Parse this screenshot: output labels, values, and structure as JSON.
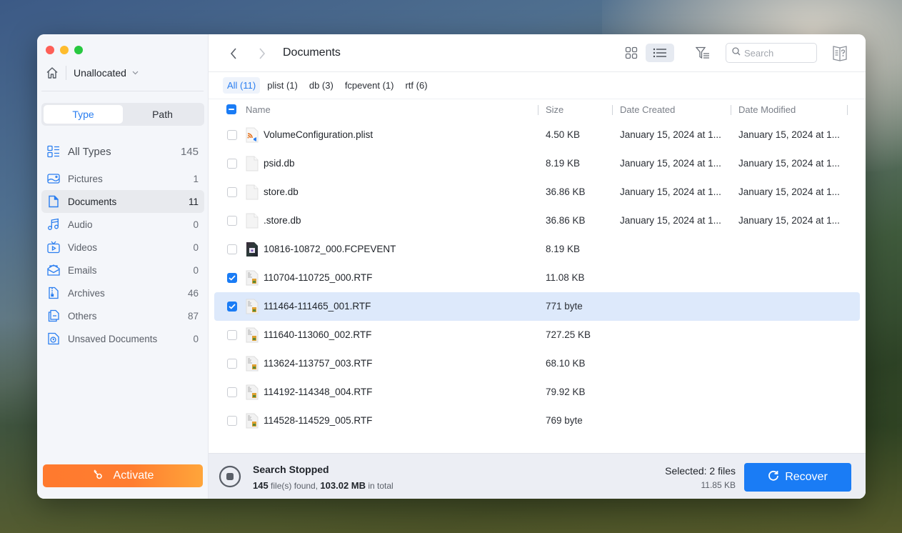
{
  "window": {
    "traffic_lights": [
      "close",
      "minimize",
      "maximize"
    ]
  },
  "sidebar": {
    "location": {
      "icon": "home-icon",
      "label": "Unallocated",
      "chevron": "chevron-down-icon"
    },
    "segments": [
      {
        "label": "Type",
        "active": true
      },
      {
        "label": "Path",
        "active": false
      }
    ],
    "types": [
      {
        "icon": "all-types-icon",
        "label": "All Types",
        "count": "145",
        "active": false
      },
      {
        "icon": "pictures-icon",
        "label": "Pictures",
        "count": "1",
        "active": false
      },
      {
        "icon": "documents-icon",
        "label": "Documents",
        "count": "11",
        "active": true
      },
      {
        "icon": "audio-icon",
        "label": "Audio",
        "count": "0",
        "active": false
      },
      {
        "icon": "videos-icon",
        "label": "Videos",
        "count": "0",
        "active": false
      },
      {
        "icon": "emails-icon",
        "label": "Emails",
        "count": "0",
        "active": false
      },
      {
        "icon": "archives-icon",
        "label": "Archives",
        "count": "46",
        "active": false
      },
      {
        "icon": "others-icon",
        "label": "Others",
        "count": "87",
        "active": false
      },
      {
        "icon": "unsaved-documents-icon",
        "label": "Unsaved Documents",
        "count": "0",
        "active": false
      }
    ],
    "activate_label": "Activate"
  },
  "toolbar": {
    "breadcrumb": "Documents",
    "search_placeholder": "Search",
    "search_value": "",
    "view_mode": "list"
  },
  "filters": [
    {
      "label": "All (11)",
      "active": true
    },
    {
      "label": "plist (1)",
      "active": false
    },
    {
      "label": "db (3)",
      "active": false
    },
    {
      "label": "fcpevent (1)",
      "active": false
    },
    {
      "label": "rtf (6)",
      "active": false
    }
  ],
  "table": {
    "columns": [
      "Name",
      "Size",
      "Date Created",
      "Date Modified"
    ],
    "header_checkbox": "mixed",
    "rows": [
      {
        "name": "VolumeConfiguration.plist",
        "type": "plist",
        "size": "4.50 KB",
        "created": "January 15, 2024 at 1...",
        "modified": "January 15, 2024 at 1...",
        "checked": false,
        "selected": false
      },
      {
        "name": "psid.db",
        "type": "db",
        "size": "8.19 KB",
        "created": "January 15, 2024 at 1...",
        "modified": "January 15, 2024 at 1...",
        "checked": false,
        "selected": false
      },
      {
        "name": "store.db",
        "type": "db",
        "size": "36.86 KB",
        "created": "January 15, 2024 at 1...",
        "modified": "January 15, 2024 at 1...",
        "checked": false,
        "selected": false
      },
      {
        "name": ".store.db",
        "type": "db",
        "size": "36.86 KB",
        "created": "January 15, 2024 at 1...",
        "modified": "January 15, 2024 at 1...",
        "checked": false,
        "selected": false
      },
      {
        "name": "10816-10872_000.FCPEVENT",
        "type": "fcpevent",
        "size": "8.19 KB",
        "created": "",
        "modified": "",
        "checked": false,
        "selected": false
      },
      {
        "name": "110704-110725_000.RTF",
        "type": "rtf",
        "size": "11.08 KB",
        "created": "",
        "modified": "",
        "checked": true,
        "selected": false
      },
      {
        "name": "111464-111465_001.RTF",
        "type": "rtf",
        "size": "771 byte",
        "created": "",
        "modified": "",
        "checked": true,
        "selected": true
      },
      {
        "name": "111640-113060_002.RTF",
        "type": "rtf",
        "size": "727.25 KB",
        "created": "",
        "modified": "",
        "checked": false,
        "selected": false
      },
      {
        "name": "113624-113757_003.RTF",
        "type": "rtf",
        "size": "68.10 KB",
        "created": "",
        "modified": "",
        "checked": false,
        "selected": false
      },
      {
        "name": "114192-114348_004.RTF",
        "type": "rtf",
        "size": "79.92 KB",
        "created": "",
        "modified": "",
        "checked": false,
        "selected": false
      },
      {
        "name": "114528-114529_005.RTF",
        "type": "rtf",
        "size": "769 byte",
        "created": "",
        "modified": "",
        "checked": false,
        "selected": false
      }
    ]
  },
  "footer": {
    "status_title": "Search Stopped",
    "files_found": "145",
    "files_found_suffix": " file(s) found, ",
    "total_size": "103.02 MB",
    "total_suffix": " in total",
    "selected_label": "Selected: 2 files",
    "selected_size": "11.85 KB",
    "recover_label": "Recover"
  },
  "colors": {
    "accent": "#1a7cf5",
    "activate": "#ff7a2e",
    "selected_row": "#dde9fb"
  }
}
